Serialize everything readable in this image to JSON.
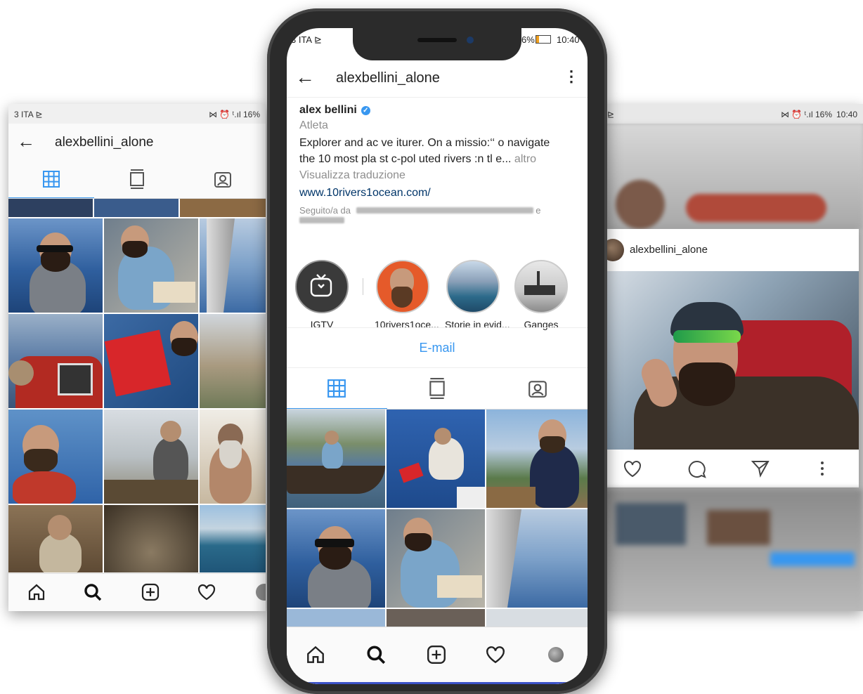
{
  "left_phone": {
    "status_left": "3 ITA ⊵",
    "status_right": "⋈ ⏰ ᵗ.ıl 16%",
    "title": "alexbellini_alone",
    "tabs": [
      "grid-icon",
      "igtv-icon",
      "tagged-icon"
    ],
    "nav": [
      "home-icon",
      "search-icon",
      "add-icon",
      "heart-icon",
      "profile-icon"
    ]
  },
  "center_phone": {
    "status_left": "3 ITA ⊵",
    "status_right": "6%",
    "status_time": "10:40",
    "header": {
      "title": "alexbellini_alone",
      "more": "⋮",
      "back": "←"
    },
    "profile": {
      "name": "alex bellini",
      "category": "Atleta",
      "bio_line1": "Explorer and ac ve iturer. On a missio:‘‘ o navigate",
      "bio_line2_a": "the 10 most pla st c-pol uted rivers :n tl e...",
      "bio_more": "altro",
      "translate": "Visualizza traduzione",
      "website": "www.10rivers1ocean.com/",
      "followed_by_prefix": "Seguito/a da",
      "followed_by_suffix": "e"
    },
    "highlights": [
      {
        "label": "IGTV"
      },
      {
        "label": "10rivers1oce..."
      },
      {
        "label": "Storie in evid..."
      },
      {
        "label": "Ganges"
      }
    ],
    "email_button": "E-mail",
    "tabs": [
      "grid-icon",
      "igtv-icon",
      "tagged-icon"
    ],
    "nav": [
      "home-icon",
      "search-icon",
      "add-icon",
      "heart-icon",
      "profile-icon"
    ]
  },
  "right_phone": {
    "status_left": "⊵",
    "status_right": "⋈ ⏰ ᵗ.ıl 16%",
    "status_time": "10:40",
    "post_username": "alexbellini_alone",
    "actions": [
      "heart-icon",
      "comment-icon",
      "share-icon",
      "more-icon"
    ]
  },
  "colors": {
    "accent": "#3897f0",
    "frame": "#2b2b2b"
  }
}
